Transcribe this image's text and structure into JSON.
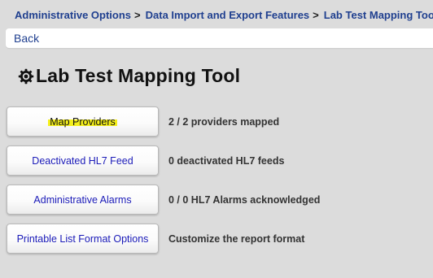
{
  "breadcrumb": {
    "items": [
      "Administrative Options",
      "Data Import and Export Features"
    ],
    "separator": ">",
    "current": "Lab Test Mapping Tool"
  },
  "nav": {
    "back_label": "Back"
  },
  "page": {
    "title": "Lab Test Mapping Tool",
    "title_icon": "gear-icon"
  },
  "actions": [
    {
      "label": "Map Providers",
      "status": "2 / 2 providers mapped",
      "highlighted": true
    },
    {
      "label": "Deactivated HL7 Feed",
      "status": "0 deactivated HL7 feeds",
      "highlighted": false
    },
    {
      "label": "Administrative Alarms",
      "status": "0 / 0 HL7 Alarms acknowledged",
      "highlighted": false
    },
    {
      "label": "Printable List Format Options",
      "status": "Customize the report format",
      "highlighted": false
    }
  ],
  "colors": {
    "background": "#dcdcdc",
    "link": "#1f3f8f",
    "button_text": "#1a1ab8",
    "highlight": "#f4ef1a"
  }
}
